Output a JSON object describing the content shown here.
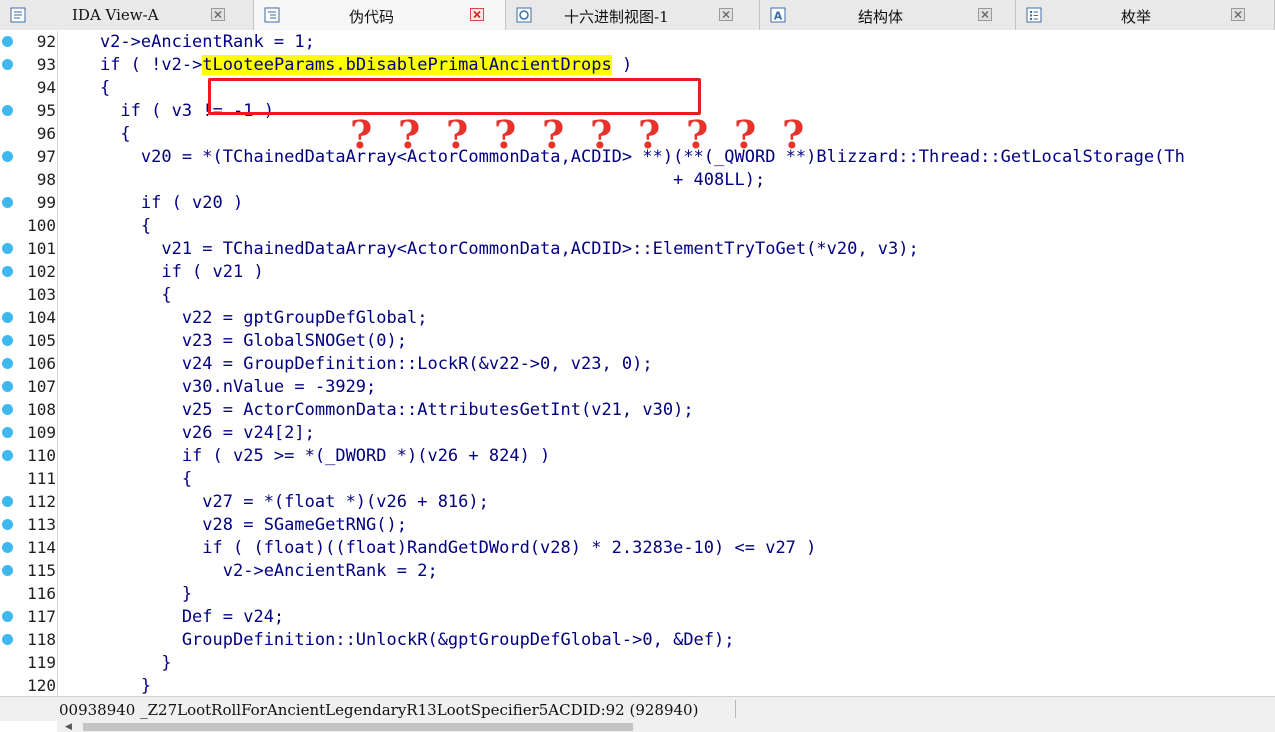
{
  "tabs": [
    {
      "label": "IDA View-A",
      "icon": "ida-view-icon",
      "active": false
    },
    {
      "label": "伪代码",
      "icon": "pseudocode-icon",
      "active": true
    },
    {
      "label": "十六进制视图-1",
      "icon": "hex-view-icon",
      "active": false
    },
    {
      "label": "结构体",
      "icon": "structures-icon",
      "active": false
    },
    {
      "label": "枚举",
      "icon": "enums-icon",
      "active": false
    }
  ],
  "code_lines": [
    {
      "num": "92",
      "bp": true
    },
    {
      "num": "93",
      "bp": true,
      "pre": "if ( !v2->",
      "hl": "tLooteeParams.bDisablePrimalAncientDrops",
      "post": " )"
    },
    {
      "num": "94",
      "bp": false
    },
    {
      "num": "95",
      "bp": true
    },
    {
      "num": "96",
      "bp": false
    },
    {
      "num": "97",
      "bp": true
    },
    {
      "num": "98",
      "bp": false
    },
    {
      "num": "99",
      "bp": true
    },
    {
      "num": "100",
      "bp": false
    },
    {
      "num": "101",
      "bp": true
    },
    {
      "num": "102",
      "bp": true
    },
    {
      "num": "103",
      "bp": false
    },
    {
      "num": "104",
      "bp": true
    },
    {
      "num": "105",
      "bp": true
    },
    {
      "num": "106",
      "bp": true
    },
    {
      "num": "107",
      "bp": true
    },
    {
      "num": "108",
      "bp": true
    },
    {
      "num": "109",
      "bp": true
    },
    {
      "num": "110",
      "bp": true
    },
    {
      "num": "111",
      "bp": false
    },
    {
      "num": "112",
      "bp": true
    },
    {
      "num": "113",
      "bp": true
    },
    {
      "num": "114",
      "bp": true
    },
    {
      "num": "115",
      "bp": true
    },
    {
      "num": "116",
      "bp": false
    },
    {
      "num": "117",
      "bp": true
    },
    {
      "num": "118",
      "bp": true
    },
    {
      "num": "119",
      "bp": false
    },
    {
      "num": "120",
      "bp": false
    }
  ],
  "code_text": [
    "    v2->eAncientRank = 1;",
    "    ",
    "    {",
    "      if ( v3 != -1 )",
    "      {",
    "        v20 = *(TChainedDataArray<ActorCommonData,ACDID> **)(**(_QWORD **)Blizzard::Thread::GetLocalStorage(Th",
    "                                                            + 408LL);",
    "        if ( v20 )",
    "        {",
    "          v21 = TChainedDataArray<ActorCommonData,ACDID>::ElementTryToGet(*v20, v3);",
    "          if ( v21 )",
    "          {",
    "            v22 = gptGroupDefGlobal;",
    "            v23 = GlobalSNOGet(0);",
    "            v24 = GroupDefinition::LockR(&v22->0, v23, 0);",
    "            v30.nValue = -3929;",
    "            v25 = ActorCommonData::AttributesGetInt(v21, v30);",
    "            v26 = v24[2];",
    "            if ( v25 >= *(_DWORD *)(v26 + 824) )",
    "            {",
    "              v27 = *(float *)(v26 + 816);",
    "              v28 = SGameGetRNG();",
    "              if ( (float)((float)RandGetDWord(v28) * 2.3283e-10) <= v27 )",
    "                v2->eAncientRank = 2;",
    "            }",
    "            Def = v24;",
    "            GroupDefinition::UnlockR(&gptGroupDefGlobal->0, &Def);",
    "          }",
    "        }"
  ],
  "question_marks": [
    "?",
    "?",
    "?",
    "?",
    "?",
    "?",
    "?",
    "?",
    "?",
    "?"
  ],
  "status": {
    "text": "00938940 _Z27LootRollForAncientLegendaryR13LootSpecifier5ACDID:92 (928940)"
  },
  "colors": {
    "code_text": "#000080",
    "highlight": "#ffff00",
    "annotation_red": "#e81c1c",
    "breakpoint_dot": "#3fb8f0"
  }
}
